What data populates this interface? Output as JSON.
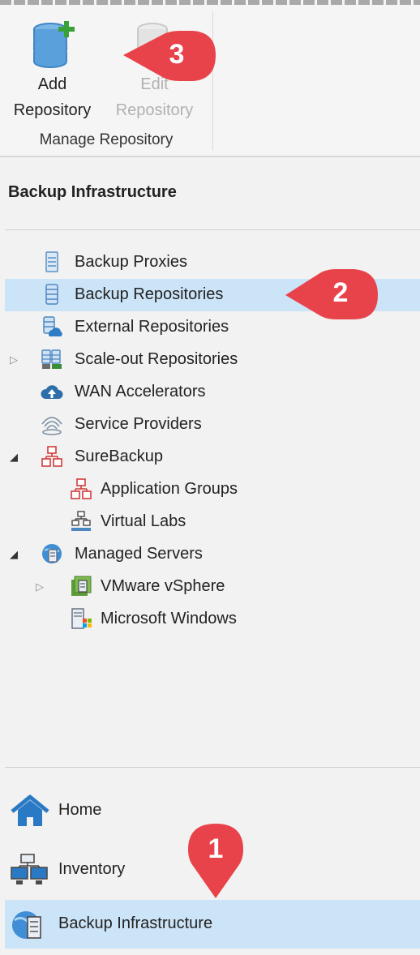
{
  "ribbon": {
    "add_repository": {
      "line1": "Add",
      "line2": "Repository",
      "icon": "add-database-icon"
    },
    "edit_repository": {
      "line1": "Edit",
      "line2": "Repository",
      "icon": "edit-database-icon",
      "disabled": true
    },
    "group_label": "Manage Repository"
  },
  "pane": {
    "title": "Backup Infrastructure"
  },
  "tree": {
    "items": [
      {
        "label": "Backup Proxies",
        "icon": "proxy-server-icon"
      },
      {
        "label": "Backup Repositories",
        "icon": "repository-icon",
        "selected": true
      },
      {
        "label": "External Repositories",
        "icon": "cloud-repository-icon"
      },
      {
        "label": "Scale-out Repositories",
        "icon": "scale-out-icon",
        "expander": "collapsed"
      },
      {
        "label": "WAN Accelerators",
        "icon": "wan-accelerator-icon"
      },
      {
        "label": "Service Providers",
        "icon": "service-provider-icon"
      },
      {
        "label": "SureBackup",
        "icon": "surebackup-icon",
        "expander": "expanded"
      },
      {
        "label": "Application Groups",
        "icon": "application-group-icon"
      },
      {
        "label": "Virtual Labs",
        "icon": "virtual-lab-icon"
      },
      {
        "label": "Managed Servers",
        "icon": "managed-servers-icon",
        "expander": "expanded"
      },
      {
        "label": "VMware vSphere",
        "icon": "vsphere-icon",
        "expander": "collapsed"
      },
      {
        "label": "Microsoft Windows",
        "icon": "windows-server-icon"
      }
    ]
  },
  "nav": {
    "items": [
      {
        "label": "Home",
        "icon": "home-icon"
      },
      {
        "label": "Inventory",
        "icon": "inventory-icon"
      },
      {
        "label": "Backup Infrastructure",
        "icon": "backup-infrastructure-icon",
        "active": true
      }
    ]
  },
  "callouts": [
    "1",
    "2",
    "3"
  ],
  "colors": {
    "selection": "#cce4f7",
    "callout": "#e8434b",
    "accent": "#2e7cc3",
    "plus": "#3aa13a"
  }
}
